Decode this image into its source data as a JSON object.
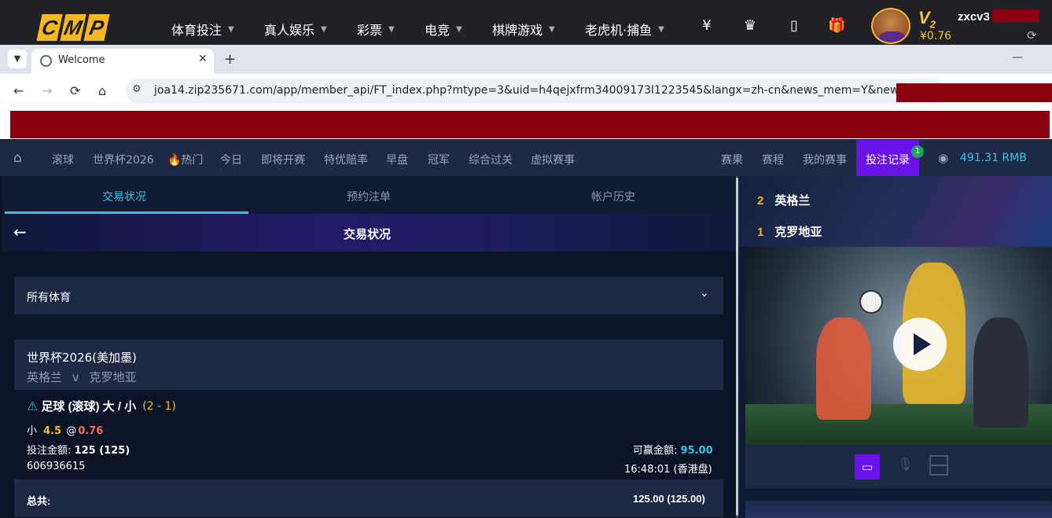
{
  "site_header": {
    "logo": [
      "C",
      "M",
      "P"
    ],
    "nav": [
      {
        "label": "体育投注"
      },
      {
        "label": "真人娱乐"
      },
      {
        "label": "彩票"
      },
      {
        "label": "电竞"
      },
      {
        "label": "棋牌游戏"
      },
      {
        "label": "老虎机·捕鱼"
      }
    ],
    "icons": [
      "deposit-icon",
      "crown-icon",
      "mobile-icon",
      "gift-icon"
    ],
    "icon_glyphs": {
      "deposit": "¥",
      "crown": "♛",
      "mobile": "▯",
      "gift": "🎁"
    },
    "vip_level": "V",
    "vip_num": "2",
    "balance": "¥0.76",
    "username": "zxcv3"
  },
  "browser": {
    "tab_title": "Welcome",
    "tab_close": "✕",
    "new_tab": "+",
    "url": "joa14.zip235671.com/app/member_api/FT_index.php?mtype=3&uid=h4qejxfrm34009173l1223545&langx=zh-cn&news_mem=Y&news_..."
  },
  "sports_nav": {
    "items": [
      {
        "label": "滚球"
      },
      {
        "label": "世界杯2026"
      },
      {
        "label": "🔥热门"
      },
      {
        "label": "今日"
      },
      {
        "label": "即将开赛"
      },
      {
        "label": "特优赔率"
      },
      {
        "label": "早盘"
      },
      {
        "label": "冠军"
      },
      {
        "label": "综合过关"
      },
      {
        "label": "虚拟赛事"
      }
    ],
    "right_items": [
      {
        "label": "赛果"
      },
      {
        "label": "赛程"
      },
      {
        "label": "我的赛事"
      }
    ],
    "bet_record": "投注记录",
    "bet_record_badge": "1",
    "balance": "491.31  RMB"
  },
  "main": {
    "subtabs": [
      "交易状况",
      "预约注单",
      "帐户历史"
    ],
    "active_subtab": 0,
    "banner_title": "交易状况",
    "sport_filter": "所有体育",
    "bet": {
      "league": "世界杯2026(美加墨)",
      "home": "英格兰",
      "vs": "v",
      "away": "克罗地亚",
      "bet_type": "足球 (滚球) 大 / 小",
      "score": "(2 - 1)",
      "pick": "小",
      "line": "4.5",
      "at": "@",
      "odds": "0.76",
      "stake_label": "投注金额:",
      "stake_value": "125 (125)",
      "win_label": "可赢金额:",
      "win_value": "95.00",
      "ticket_id": "606936615",
      "time": "16:48:01 (香港盘)"
    },
    "total_label": "总共:",
    "total_value": "125.00 (125.00)"
  },
  "right_panel": {
    "scores": [
      {
        "num": "2",
        "team": "英格兰"
      },
      {
        "num": "1",
        "team": "克罗地亚"
      }
    ]
  },
  "colors": {
    "accent": "#6a13e8",
    "highlight": "#32c4e8",
    "gold": "#f5b822",
    "odds_red": "#ff6b5b",
    "panel": "#1e2a45",
    "bg": "#0b1427"
  }
}
